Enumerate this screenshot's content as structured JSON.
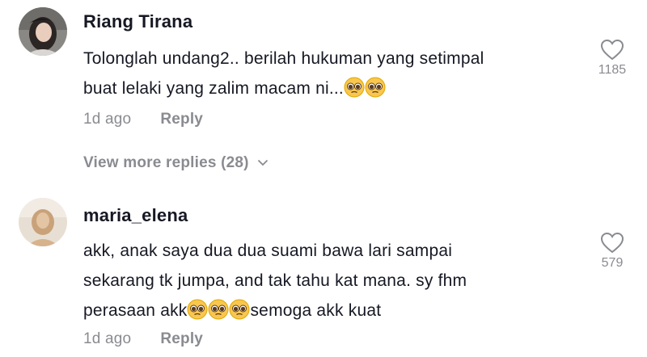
{
  "comments": [
    {
      "username": "Riang Tirana",
      "lines": [
        "Tolonglah undang2.. berilah hukuman yang setimpal",
        "buat lelaki yang zalim macam ni..."
      ],
      "emojis_line2": [
        "pleading-face",
        "pleading-face"
      ],
      "time": "1d ago",
      "reply_label": "Reply",
      "likes": "1185",
      "view_more": "View more replies (28)"
    },
    {
      "username": "maria_elena",
      "lines": [
        "akk, anak saya dua dua suami bawa lari sampai",
        "sekarang tk jumpa, and tak tahu kat mana. sy fhm",
        "perasaan akk",
        "semoga akk kuat"
      ],
      "emojis_line3": [
        "pleading-face",
        "pleading-face",
        "pleading-face"
      ],
      "time": "1d ago",
      "reply_label": "Reply",
      "likes": "579"
    }
  ],
  "colors": {
    "text_primary": "#161823",
    "text_secondary": "#8a8b91",
    "background": "#ffffff"
  }
}
